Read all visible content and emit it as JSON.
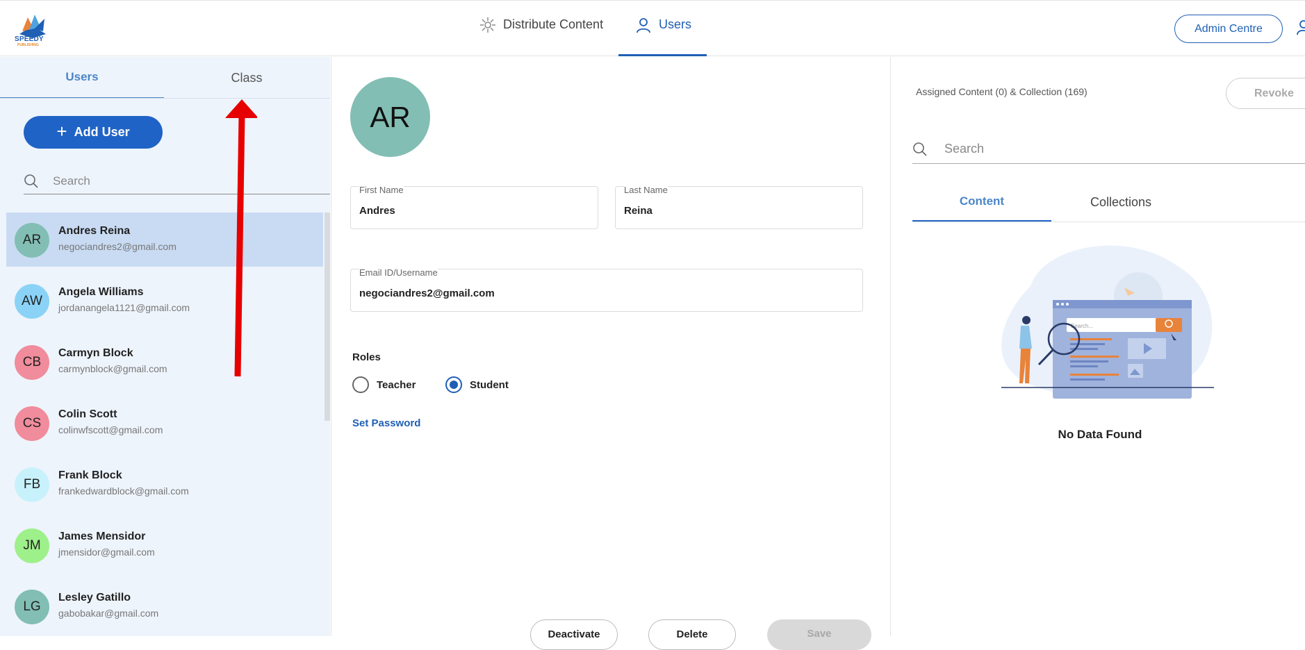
{
  "brand": {
    "logo_text": "SPEEDY",
    "logo_sub": "PUBLISHING"
  },
  "topnav": {
    "distribute_label": "Distribute Content",
    "users_label": "Users",
    "admin_label": "Admin Centre"
  },
  "left": {
    "tabs": [
      {
        "label": "Users"
      },
      {
        "label": "Class"
      }
    ],
    "add_user_label": "Add User",
    "search_placeholder": "Search",
    "users": [
      {
        "initials": "AR",
        "name": "Andres Reina",
        "email": "negociandres2@gmail.com",
        "color": "#82beb4",
        "selected": true
      },
      {
        "initials": "AW",
        "name": "Angela Williams",
        "email": "jordanangela1121@gmail.com",
        "color": "#8ad3f7",
        "selected": false
      },
      {
        "initials": "CB",
        "name": "Carmyn Block",
        "email": "carmynblock@gmail.com",
        "color": "#f08c9c",
        "selected": false
      },
      {
        "initials": "CS",
        "name": "Colin Scott",
        "email": "colinwfscott@gmail.com",
        "color": "#f08c9c",
        "selected": false
      },
      {
        "initials": "FB",
        "name": "Frank Block",
        "email": "frankedwardblock@gmail.com",
        "color": "#c8f2fb",
        "selected": false
      },
      {
        "initials": "JM",
        "name": "James Mensidor",
        "email": "jmensidor@gmail.com",
        "color": "#9ef08a",
        "selected": false
      },
      {
        "initials": "LG",
        "name": "Lesley Gatillo",
        "email": "gabobakar@gmail.com",
        "color": "#82beb4",
        "selected": false
      }
    ]
  },
  "detail": {
    "initials": "AR",
    "first_name_label": "First Name",
    "first_name": "Andres",
    "last_name_label": "Last Name",
    "last_name": "Reina",
    "email_label": "Email ID/Username",
    "email": "negociandres2@gmail.com",
    "roles_label": "Roles",
    "role_teacher": "Teacher",
    "role_student": "Student",
    "selected_role": "Student",
    "set_password": "Set Password",
    "deactivate": "Deactivate",
    "delete": "Delete",
    "save": "Save"
  },
  "right": {
    "assigned_text": "Assigned Content (0) & Collection (169)",
    "revoke_label": "Revoke",
    "search_placeholder": "Search",
    "tabs": [
      {
        "label": "Content"
      },
      {
        "label": "Collections"
      }
    ],
    "illustration_search_text": "Search...",
    "empty_text": "No Data Found"
  },
  "colors": {
    "accent": "#1f63c6",
    "annotation_arrow": "#e60000"
  }
}
